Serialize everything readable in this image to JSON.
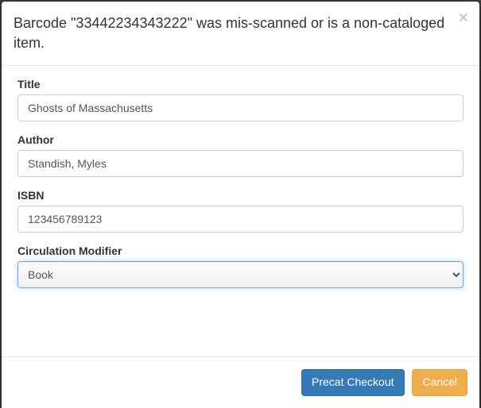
{
  "header": {
    "message": "Barcode \"33442234343222\" was mis-scanned or is a non-cataloged item.",
    "close_glyph": "×"
  },
  "form": {
    "title": {
      "label": "Title",
      "value": "Ghosts of Massachusetts"
    },
    "author": {
      "label": "Author",
      "value": "Standish, Myles"
    },
    "isbn": {
      "label": "ISBN",
      "value": "123456789123"
    },
    "circ_modifier": {
      "label": "Circulation Modifier",
      "value": "Book"
    }
  },
  "footer": {
    "precat_checkout_label": "Precat Checkout",
    "cancel_label": "Cancel"
  }
}
